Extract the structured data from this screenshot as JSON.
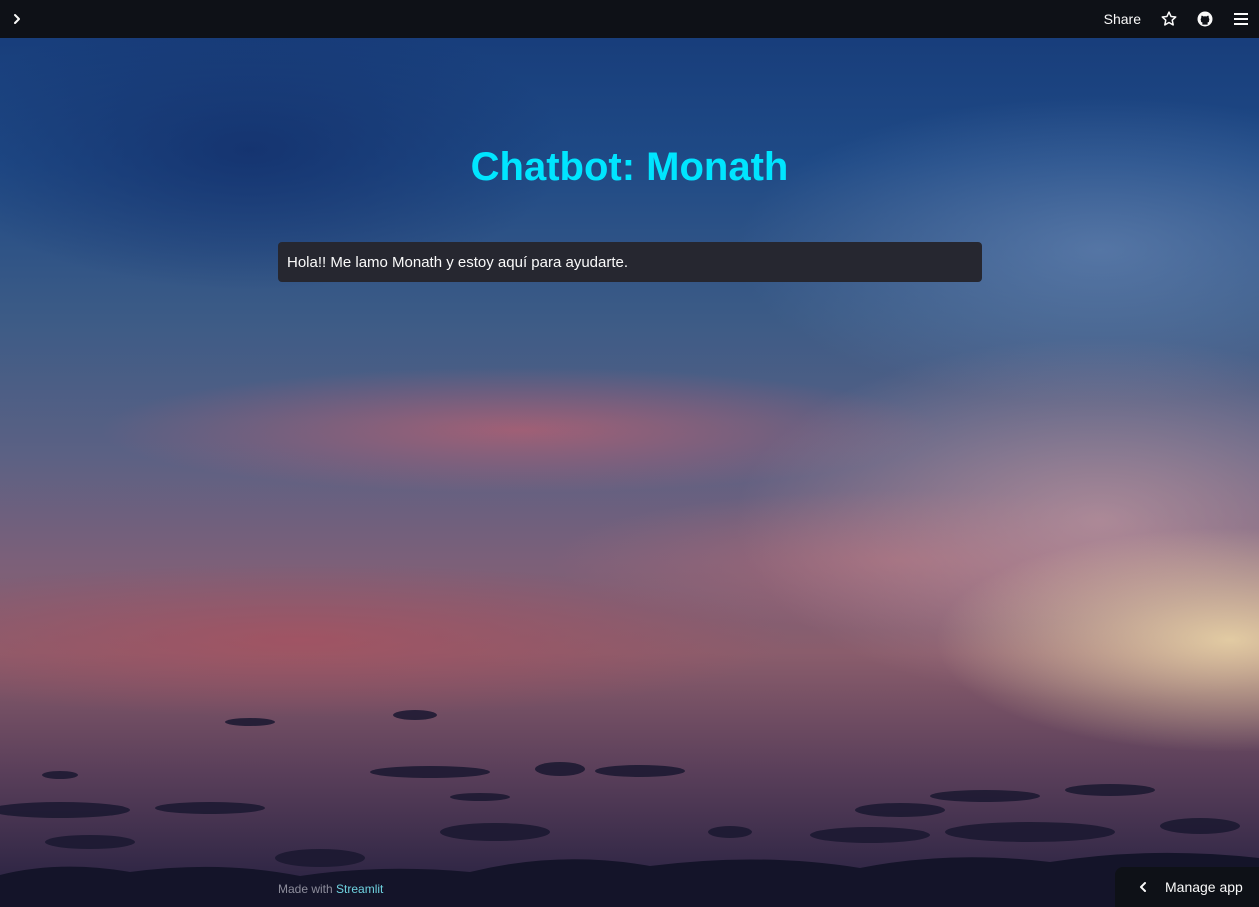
{
  "toolbar": {
    "sidebar_toggle_icon": "chevron-right-icon",
    "share_label": "Share",
    "star_icon": "star-icon",
    "github_icon": "github-icon",
    "menu_icon": "hamburger-menu-icon"
  },
  "main": {
    "title": "Chatbot: Monath",
    "message": "Hola!! Me lamo Monath y estoy aquí para ayudarte."
  },
  "footer": {
    "made_with": "Made with",
    "streamlit_label": "Streamlit"
  },
  "manage_app": {
    "label": "Manage app",
    "icon": "chevron-left-icon"
  },
  "colors": {
    "title": "#00e5ff",
    "toolbar_bg": "#0e1117",
    "message_bg": "#262730",
    "link": "#6fd3e0"
  }
}
